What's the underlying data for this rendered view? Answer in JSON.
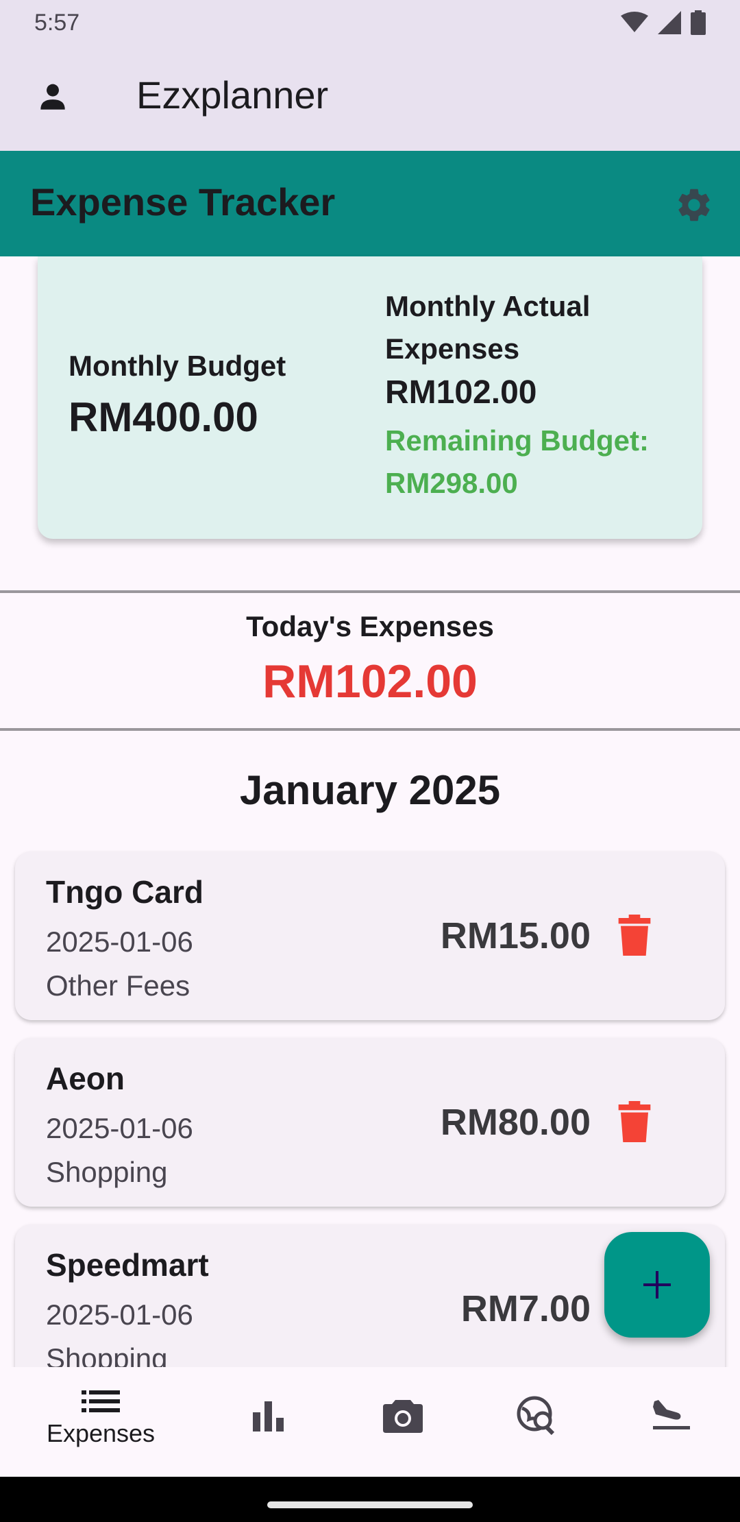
{
  "status_bar": {
    "time": "5:57"
  },
  "app_bar": {
    "title": "Ezxplanner",
    "profile_icon": "person-icon"
  },
  "header": {
    "title": "Expense Tracker",
    "settings_icon": "gear-icon"
  },
  "summary": {
    "budget_label": "Monthly Budget",
    "budget_value": "RM400.00",
    "actual_label_line1": "Monthly Actual",
    "actual_label_line2": "Expenses",
    "actual_value": "RM102.00",
    "remaining_line1": "Remaining Budget:",
    "remaining_line2": "RM298.00"
  },
  "today": {
    "label": "Today's Expenses",
    "value": "RM102.00"
  },
  "month_heading": "January 2025",
  "expenses": [
    {
      "title": "Tngo Card",
      "date": "2025-01-06",
      "category": "Other Fees",
      "amount": "RM15.00"
    },
    {
      "title": "Aeon",
      "date": "2025-01-06",
      "category": "Shopping",
      "amount": "RM80.00"
    },
    {
      "title": "Speedmart",
      "date": "2025-01-06",
      "category": "Shopping",
      "amount": "RM7.00"
    }
  ],
  "bottom_nav": {
    "items": [
      {
        "label": "Expenses",
        "icon": "list-icon",
        "selected": true
      },
      {
        "label": "",
        "icon": "bar-chart-icon"
      },
      {
        "label": "",
        "icon": "camera-icon"
      },
      {
        "label": "",
        "icon": "travel-explore-icon"
      },
      {
        "label": "",
        "icon": "flight-land-icon"
      }
    ]
  },
  "colors": {
    "header": "#0a8a82",
    "summary_card": "#dff1ee",
    "remaining": "#4caf50",
    "today_value": "#e53935",
    "delete": "#f44336",
    "fab": "#009688"
  }
}
